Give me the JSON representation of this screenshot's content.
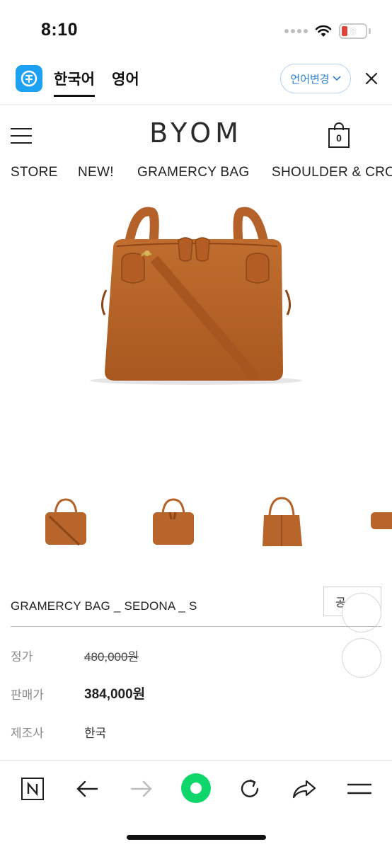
{
  "status_bar": {
    "time": "8:10",
    "battery": "8",
    "battery_color": "#e0443b"
  },
  "translate_bar": {
    "logo_icon": "papago-translate-icon",
    "active_language": "한국어",
    "other_language": "영어",
    "change_language_label": "언어변경",
    "close_icon": "close-icon",
    "accent": "#2a7fd6"
  },
  "store_header": {
    "logo": "BYOM",
    "cart_count": "0"
  },
  "categories": [
    "STORE",
    "NEW!",
    "GRAMERCY BAG",
    "SHOULDER & CRO"
  ],
  "product": {
    "main_image_alt": "brown leather handbag",
    "bag_color": "#b8652b",
    "name": "GRAMERCY BAG _ SEDONA _ S",
    "share_label": "공",
    "info": [
      {
        "label": "정가",
        "value": "480,000원"
      },
      {
        "label": "판매가",
        "value": "384,000원"
      },
      {
        "label": "제조사",
        "value": "한국"
      }
    ]
  },
  "toolbar": {
    "items": [
      "naver-n-icon",
      "back-arrow-icon",
      "forward-arrow-icon",
      "green-dot-icon",
      "refresh-icon",
      "share-icon",
      "menu-icon"
    ],
    "green": "#0ed66a"
  }
}
